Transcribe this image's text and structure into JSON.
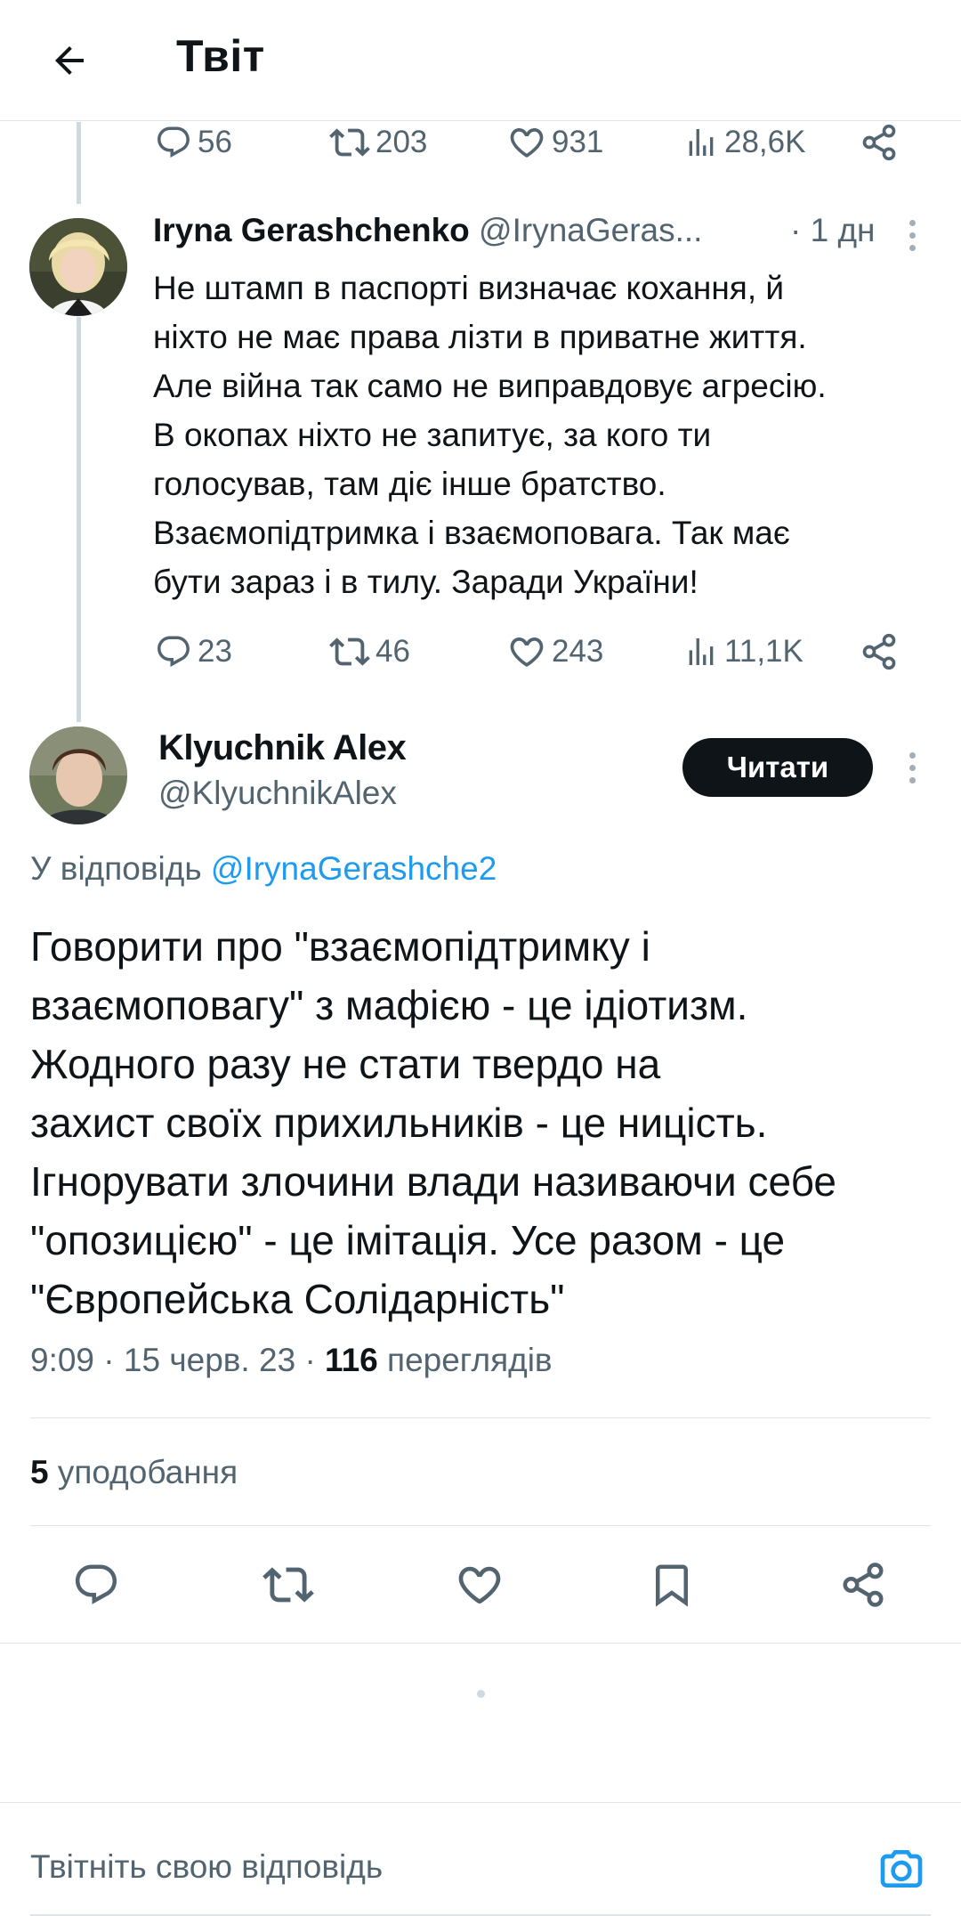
{
  "header": {
    "title": "Твіт",
    "back_icon": "arrow-left-icon"
  },
  "parent_tweet_stats": {
    "replies": "56",
    "retweets": "203",
    "likes": "931",
    "views": "28,6K"
  },
  "reply_tweet": {
    "author_name": "Iryna Gerashchenko",
    "author_handle": "@IrynaGeras...",
    "time": "· 1 дн",
    "text_lines": [
      "Не штамп в паспорті визначає кохання, й",
      "ніхто не має права лізти в приватне життя.",
      "Але війна так само не виправдовує агресію.",
      "В окопах ніхто не запитує, за кого ти",
      "голосував, там діє інше братство.",
      "Взаємопідтримка і взаємоповага. Так має",
      "бути зараз і в тилу. Заради України!"
    ],
    "stats": {
      "replies": "23",
      "retweets": "46",
      "likes": "243",
      "views": "11,1K"
    }
  },
  "main_tweet": {
    "author_name": "Klyuchnik Alex",
    "author_handle": "@KlyuchnikAlex",
    "follow_label": "Читати",
    "reply_prefix": "У відповідь",
    "reply_mention": "@IrynaGerashche2",
    "text_lines": [
      "Говорити про \"взаємопідтримку і",
      "взаємоповагу\" з мафією - це ідіотизм.",
      "Жодного разу не стати твердо на",
      "захист своїх прихильників - це ницість.",
      "Ігнорувати злочини влади називаючи себе",
      "\"опозицією\" - це імітація. Усе разом - це",
      "\"Європейська Солідарність\""
    ],
    "time": "9:09",
    "date": "15 черв. 23",
    "views_count": "116",
    "views_label": "переглядів",
    "likes_count": "5",
    "likes_label": "уподобання"
  },
  "composer": {
    "placeholder": "Твітніть свою відповідь",
    "camera_icon": "camera-icon"
  },
  "colors": {
    "accent": "#1d9bf0",
    "muted": "#536471",
    "text": "#0f1419",
    "divider": "#dfe5ea",
    "follow_button": "#0f1419"
  }
}
